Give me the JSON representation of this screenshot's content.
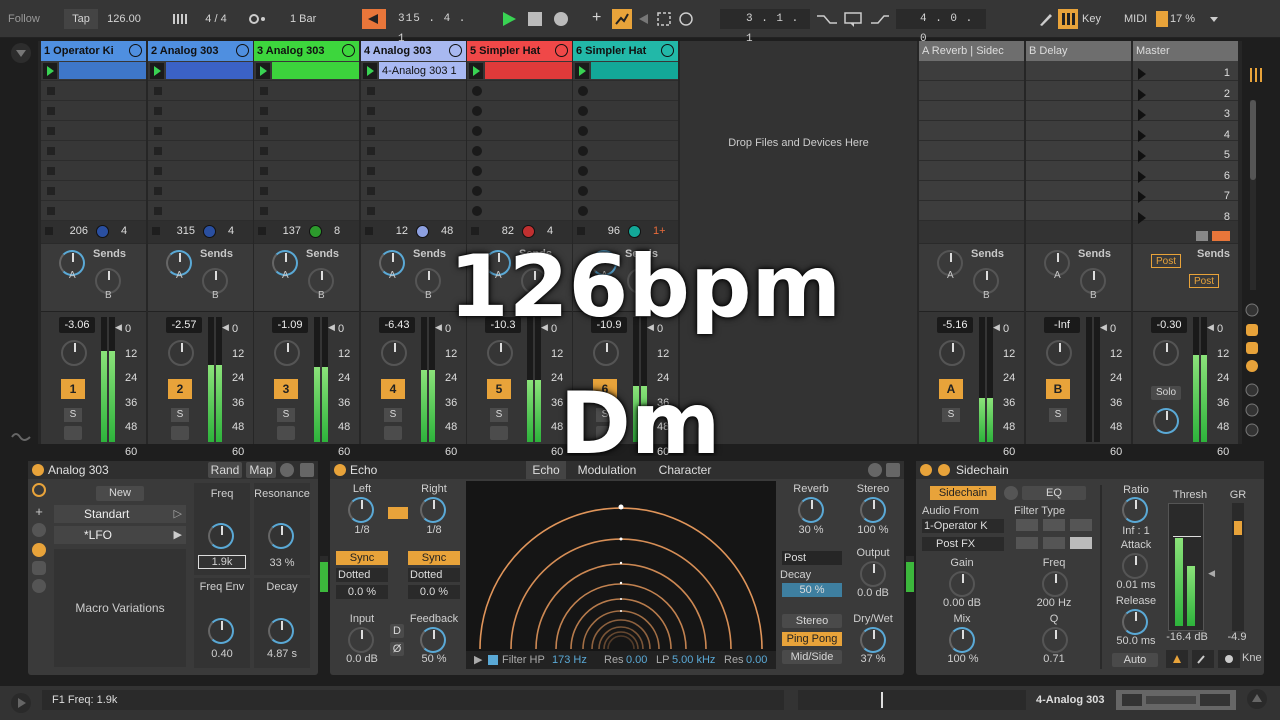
{
  "transport": {
    "follow": "Follow",
    "tap": "Tap",
    "tempo": "126.00",
    "time_signature": "4 / 4",
    "quantize": "1 Bar",
    "position": "315 .  4 .  1",
    "loop_start": "3 .  1 .  1",
    "loop_length": "4 .  0 .  0",
    "key": "Key",
    "midi": "MIDI",
    "cpu": "17 %"
  },
  "tracks": [
    {
      "name": "1 Operator Ki",
      "color": "#4f8fe0",
      "clip_color": "#3e77c9",
      "clip_name": "",
      "info_left": "206",
      "info_right": "4",
      "volume": "-3.06",
      "number": "1",
      "meter": 0.73
    },
    {
      "name": "2 Analog 303",
      "color": "#4f8fe0",
      "clip_color": "#3b62c6",
      "clip_name": "",
      "info_left": "315",
      "info_right": "4",
      "volume": "-2.57",
      "number": "2",
      "meter": 0.62
    },
    {
      "name": "3 Analog 303",
      "color": "#3dd63d",
      "clip_color": "#3cd33c",
      "clip_name": "",
      "info_left": "137",
      "info_right": "8",
      "volume": "-1.09",
      "number": "3",
      "meter": 0.6
    },
    {
      "name": "4 Analog 303",
      "color": "#a8b8f0",
      "clip_color": "#a9b9f2",
      "clip_name": "4-Analog 303 1",
      "info_left": "12",
      "info_right": "48",
      "volume": "-6.43",
      "number": "4",
      "meter": 0.58
    },
    {
      "name": "5 Simpler Hat",
      "color": "#f04848",
      "clip_color": "#e03a3a",
      "clip_name": "",
      "info_left": "82",
      "info_right": "4",
      "volume": "-10.3",
      "number": "5",
      "meter": 0.5
    },
    {
      "name": "6 Simpler Hat",
      "color": "#22b8a8",
      "clip_color": "#13a898",
      "clip_name": "",
      "info_left": "96",
      "info_right": "1+",
      "volume": "-10.9",
      "number": "6",
      "meter": 0.45
    }
  ],
  "returns": [
    {
      "name": "A Reverb | Sidec",
      "volume": "-5.16",
      "letter": "A",
      "meter": 0.35
    },
    {
      "name": "B Delay",
      "volume": "-Inf",
      "letter": "B",
      "meter": 0.0
    }
  ],
  "master": {
    "name": "Master",
    "volume": "-0.30",
    "solo": "Solo",
    "post1": "Post",
    "post2": "Post",
    "meter": 0.7
  },
  "scenes": [
    "1",
    "2",
    "3",
    "4",
    "5",
    "6",
    "7",
    "8"
  ],
  "sends_label": "Sends",
  "send_a": "A",
  "send_b": "B",
  "drop_text": "Drop Files and Devices Here",
  "meter_scale": [
    "0",
    "12",
    "24",
    "36",
    "48",
    "60"
  ],
  "solo_label": "S",
  "overlay": {
    "bpm": "126bpm",
    "key": "Dm"
  },
  "analog": {
    "title": "Analog 303",
    "rand": "Rand",
    "map": "Map",
    "new": "New",
    "preset1": "Standart",
    "preset2": "*LFO",
    "macro_var": "Macro Variations",
    "freq_label": "Freq",
    "freq_value": "1.9k",
    "reso_label": "Resonance",
    "reso_value": "33 %",
    "fenv_label": "Freq Env",
    "fenv_value": "0.40",
    "decay_label": "Decay",
    "decay_value": "4.87 s"
  },
  "echo": {
    "title": "Echo",
    "tabs": [
      "Echo",
      "Modulation",
      "Character"
    ],
    "left": "Left",
    "right": "Right",
    "left_val": "1/8",
    "right_val": "1/8",
    "sync": "Sync",
    "dotted": "Dotted",
    "pct_left": "0.0 %",
    "pct_right": "0.0 %",
    "input": "Input",
    "input_val": "0.0 dB",
    "feedback": "Feedback",
    "feedback_val": "50 %",
    "d_btn": "D",
    "phase_btn": "Ø",
    "reverb": "Reverb",
    "reverb_val": "30 %",
    "stereo": "Stereo",
    "stereo_val": "100 %",
    "post": "Post",
    "decay": "Decay",
    "decay_val": "50 %",
    "output": "Output",
    "output_val": "0.0 dB",
    "stereo_btn": "Stereo",
    "pingpong": "Ping Pong",
    "midside": "Mid/Side",
    "drywet": "Dry/Wet",
    "drywet_val": "37 %",
    "filter_hp": "Filter HP",
    "hp_val": "173 Hz",
    "res1": "Res",
    "res1_val": "0.00",
    "lp": "LP",
    "lp_val": "5.00 kHz",
    "res2": "Res",
    "res2_val": "0.00"
  },
  "sidechain": {
    "title": "Sidechain",
    "sc_btn": "Sidechain",
    "eq": "EQ",
    "audio_from": "Audio From",
    "source": "1-Operator K",
    "postfx": "Post FX",
    "filter_type": "Filter Type",
    "gain": "Gain",
    "gain_val": "0.00 dB",
    "freq": "Freq",
    "freq_val": "200 Hz",
    "mix": "Mix",
    "mix_val": "100 %",
    "q": "Q",
    "q_val": "0.71",
    "ratio": "Ratio",
    "ratio_val": "Inf : 1",
    "attack": "Attack",
    "attack_val": "0.01 ms",
    "release": "Release",
    "release_val": "50.0 ms",
    "auto": "Auto",
    "thresh": "Thresh",
    "gr": "GR",
    "thresh_val": "-16.4 dB",
    "gr_val": "-4.9",
    "knee": "Kne"
  },
  "status": {
    "text": "F1 Freq: 1.9k",
    "track": "4-Analog 303"
  }
}
